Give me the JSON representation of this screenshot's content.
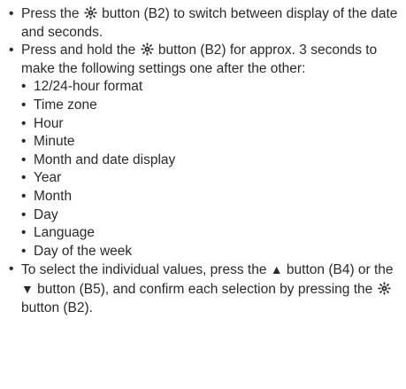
{
  "intro_items": [
    {
      "pre": "Press the",
      "post": "button (B2) to switch between display of the date and seconds."
    },
    {
      "pre": "Press and hold the",
      "post": "button (B2) for approx. 3 seconds to make the following settings one after the other:"
    }
  ],
  "settings_list": [
    "12/24-hour format",
    "Time zone",
    "Hour",
    "Minute",
    "Month and date display",
    "Year",
    "Month",
    "Day",
    "Language",
    "Day of the week"
  ],
  "final_item": {
    "part1": "To select the individual values, press the",
    "up_symbol": "▲",
    "part2": "button (B4) or the",
    "down_symbol": "▼",
    "part3": "button (B5), and confirm each selection by pressing the",
    "part4": "button (B2)."
  },
  "icons": {
    "set_button": "gear-sun-icon"
  },
  "colors": {
    "text": "#2a2a2a"
  }
}
